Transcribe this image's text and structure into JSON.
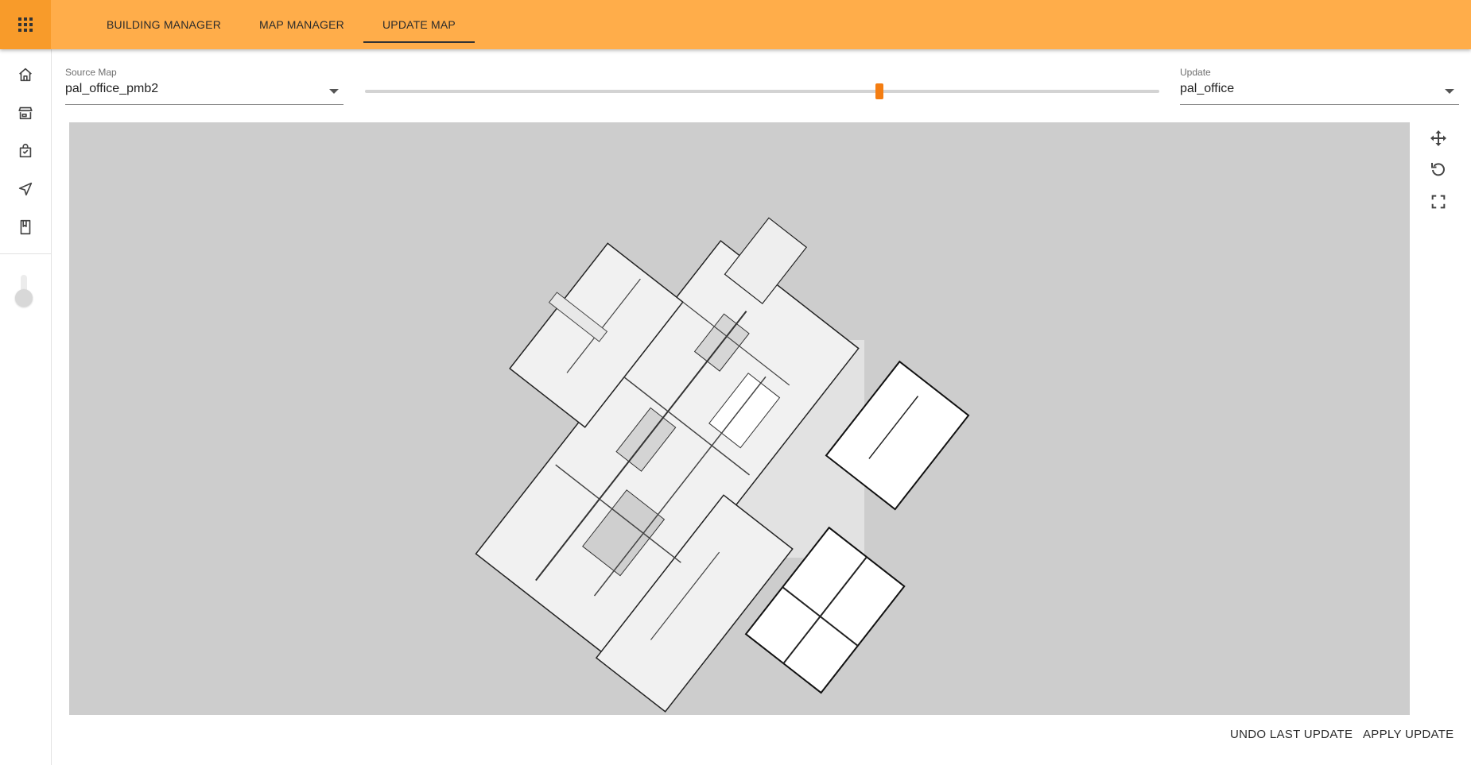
{
  "nav": {
    "apps_icon": "apps-grid-icon",
    "tabs": [
      {
        "label": "BUILDING MANAGER",
        "active": false
      },
      {
        "label": "MAP MANAGER",
        "active": false
      },
      {
        "label": "UPDATE MAP",
        "active": true
      }
    ]
  },
  "sidebar": {
    "items": [
      {
        "icon": "home-icon"
      },
      {
        "icon": "store-icon"
      },
      {
        "icon": "shopping-bag-icon"
      },
      {
        "icon": "navigation-icon"
      },
      {
        "icon": "book-icon"
      }
    ],
    "toggle_on": false
  },
  "source_map": {
    "label": "Source Map",
    "value": "pal_office_pmb2"
  },
  "update": {
    "label": "Update",
    "value": "pal_office"
  },
  "slider": {
    "value_fraction": 0.648
  },
  "map_tools": [
    {
      "icon": "move-icon"
    },
    {
      "icon": "rotate-icon"
    },
    {
      "icon": "fullscreen-icon"
    }
  ],
  "actions": {
    "undo_label": "UNDO LAST UPDATE",
    "apply_label": "APPLY UPDATE"
  },
  "colors": {
    "topbar": "#ffad4a",
    "apps_button": "#f89b2a",
    "slider_thumb": "#f47d11",
    "map_background": "#cdcdcd"
  }
}
